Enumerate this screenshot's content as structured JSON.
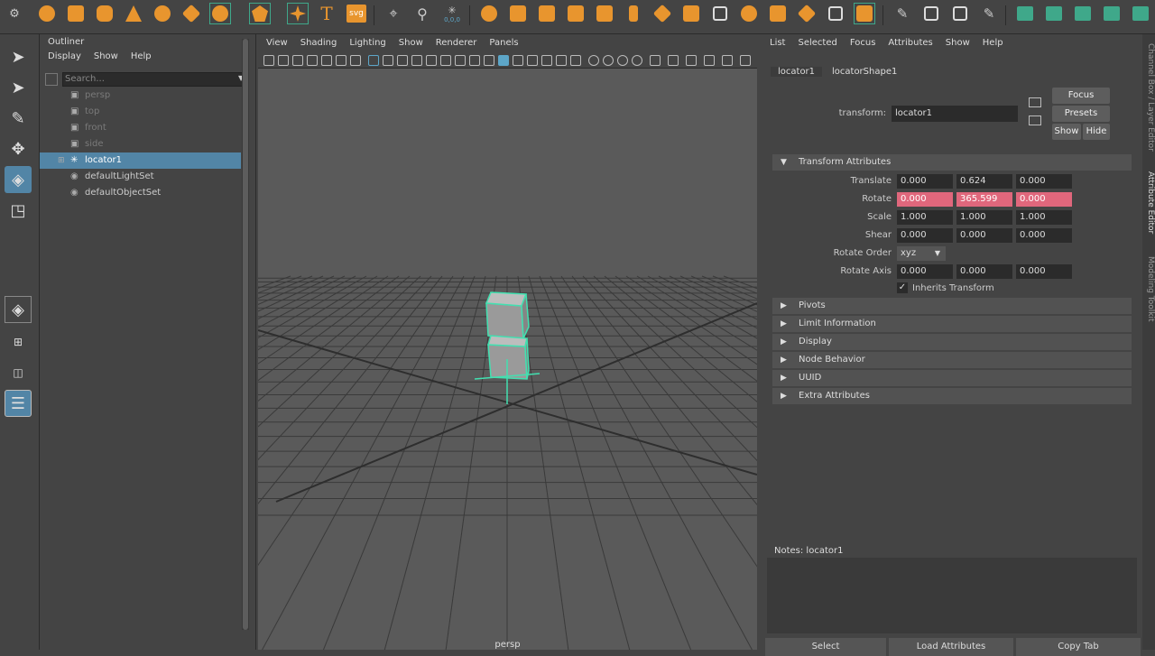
{
  "colors": {
    "selection": "#5285a6",
    "accent_orange": "#e8952e",
    "accent_green": "#3fa88a",
    "keyed_red": "#e0677c",
    "wire_highlight": "#42e0b0"
  },
  "shelf": {
    "coord_label": "0,0,0",
    "text_icon": "T",
    "svg_icon": "svg"
  },
  "outliner": {
    "tab": "Outliner",
    "menu": [
      "Display",
      "Show",
      "Help"
    ],
    "search_placeholder": "Search...",
    "items": [
      {
        "label": "persp",
        "icon": "camera-icon"
      },
      {
        "label": "top",
        "icon": "camera-icon"
      },
      {
        "label": "front",
        "icon": "camera-icon"
      },
      {
        "label": "side",
        "icon": "camera-icon"
      },
      {
        "label": "locator1",
        "icon": "locator-icon",
        "selected": true
      },
      {
        "label": "defaultLightSet",
        "icon": "set-icon"
      },
      {
        "label": "defaultObjectSet",
        "icon": "set-icon"
      }
    ]
  },
  "viewport": {
    "menu": [
      "View",
      "Shading",
      "Lighting",
      "Show",
      "Renderer",
      "Panels"
    ],
    "camera": "persp"
  },
  "attr_editor": {
    "menu": [
      "List",
      "Selected",
      "Focus",
      "Attributes",
      "Show",
      "Help"
    ],
    "tabs": [
      "locator1",
      "locatorShape1"
    ],
    "transform_label": "transform:",
    "transform_value": "locator1",
    "buttons": {
      "focus": "Focus",
      "presets": "Presets",
      "show": "Show",
      "hide": "Hide"
    },
    "section": "Transform Attributes",
    "rows": [
      {
        "label": "Translate",
        "values": [
          "0.000",
          "0.624",
          "0.000"
        ]
      },
      {
        "label": "Rotate",
        "values": [
          "0.000",
          "365.599",
          "0.000"
        ]
      },
      {
        "label": "Scale",
        "values": [
          "1.000",
          "1.000",
          "1.000"
        ]
      },
      {
        "label": "Shear",
        "values": [
          "0.000",
          "0.000",
          "0.000"
        ]
      }
    ],
    "rotate_order_label": "Rotate Order",
    "rotate_order_value": "xyz",
    "rotate_axis": {
      "label": "Rotate Axis",
      "values": [
        "0.000",
        "0.000",
        "0.000"
      ]
    },
    "inherits_label": "Inherits Transform",
    "collapsed": [
      "Pivots",
      "Limit Information",
      "Display",
      "Node Behavior",
      "UUID",
      "Extra Attributes"
    ],
    "notes_label": "Notes: locator1",
    "bottom": [
      "Select",
      "Load Attributes",
      "Copy Tab"
    ]
  },
  "right_tabs": [
    "Channel Box / Layer Editor",
    "Attribute Editor",
    "Modeling Toolkit"
  ]
}
